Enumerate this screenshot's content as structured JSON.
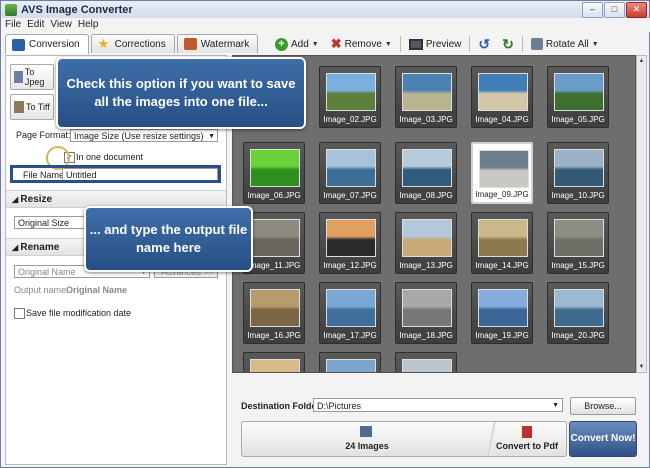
{
  "window": {
    "title": "AVS Image Converter"
  },
  "menu": [
    "File",
    "Edit",
    "View",
    "Help"
  ],
  "tabs": [
    {
      "label": "Conversion",
      "icon": "conversion-icon",
      "color": "#2a5fa8"
    },
    {
      "label": "Corrections",
      "icon": "star-icon",
      "color": "#e8b21a"
    },
    {
      "label": "Watermark",
      "icon": "watermark-icon",
      "color": "#c05a2a"
    }
  ],
  "toolbar": {
    "add": "Add",
    "remove": "Remove",
    "preview": "Preview",
    "rotate_all": "Rotate All"
  },
  "left": {
    "to_jpeg": "To Jpeg",
    "to_tiff": "To Tiff",
    "page_format_label": "Page Format:",
    "page_format_value": "Image Size (Use resize settings)",
    "one_doc_label": "In one document",
    "file_name_label": "File Name:",
    "file_name_value": "Untitled",
    "resize_title": "Resize",
    "resize_value": "Original Size",
    "rename_title": "Rename",
    "rename_value": "Original Name",
    "advanced_label": "Advanced >>",
    "output_name_label": "Output name:",
    "output_name_value": "Original Name",
    "save_date_label": "Save file modification date"
  },
  "images": [
    {
      "name": "",
      "colors": [
        "#6d9ccc",
        "#7f9a52"
      ]
    },
    {
      "name": "Image_02.JPG",
      "colors": [
        "#7ab0de",
        "#5d7f3a"
      ]
    },
    {
      "name": "Image_03.JPG",
      "colors": [
        "#4b82b3",
        "#b9b38f"
      ]
    },
    {
      "name": "Image_04.JPG",
      "colors": [
        "#3f7fb5",
        "#d2c8a8"
      ]
    },
    {
      "name": "Image_05.JPG",
      "colors": [
        "#6a9cc9",
        "#3f6f2f"
      ]
    },
    {
      "name": "Image_06.JPG",
      "colors": [
        "#6bd13a",
        "#2f8f1f"
      ]
    },
    {
      "name": "Image_07.JPG",
      "colors": [
        "#a8c2dc",
        "#3d6f96"
      ]
    },
    {
      "name": "Image_08.JPG",
      "colors": [
        "#b5cbd9",
        "#2e5b7e"
      ]
    },
    {
      "name": "Image_09.JPG",
      "colors": [
        "#6d7f8c",
        "#c9c9c4"
      ]
    },
    {
      "name": "Image_10.JPG",
      "colors": [
        "#9db2c6",
        "#345975"
      ]
    },
    {
      "name": "Image_11.JPG",
      "colors": [
        "#8f8a80",
        "#6a665e"
      ]
    },
    {
      "name": "Image_12.JPG",
      "colors": [
        "#e0a060",
        "#2b2b2b"
      ]
    },
    {
      "name": "Image_13.JPG",
      "colors": [
        "#b3c9db",
        "#caa97a"
      ]
    },
    {
      "name": "Image_14.JPG",
      "colors": [
        "#c8b88a",
        "#8a7a4e"
      ]
    },
    {
      "name": "Image_15.JPG",
      "colors": [
        "#8e8d84",
        "#6e6d66"
      ]
    },
    {
      "name": "Image_16.JPG",
      "colors": [
        "#b89b6c",
        "#7b6645"
      ]
    },
    {
      "name": "Image_17.JPG",
      "colors": [
        "#7aa8d4",
        "#3f6f9a"
      ]
    },
    {
      "name": "Image_18.JPG",
      "colors": [
        "#a9a9a9",
        "#777777"
      ]
    },
    {
      "name": "Image_19.JPG",
      "colors": [
        "#85aede",
        "#3a6797"
      ]
    },
    {
      "name": "Image_20.JPG",
      "colors": [
        "#9cb8d2",
        "#3e6a8e"
      ]
    },
    {
      "name": "",
      "colors": [
        "#d9b88a",
        "#9a7b55"
      ]
    },
    {
      "name": "",
      "colors": [
        "#7aa4cc",
        "#4b79a3"
      ]
    },
    {
      "name": "",
      "colors": [
        "#bcc4cc",
        "#6f8391"
      ]
    }
  ],
  "bottom": {
    "dest_label": "Destination Folder:",
    "dest_value": "D:\\Pictures",
    "browse": "Browse...",
    "images_count": "24 Images",
    "convert_to": "Convert to Pdf",
    "convert_now": "Convert Now!"
  },
  "callouts": {
    "one_file": "Check this option if you want to save all the images into one file...",
    "file_name": "... and type the output file name here"
  }
}
